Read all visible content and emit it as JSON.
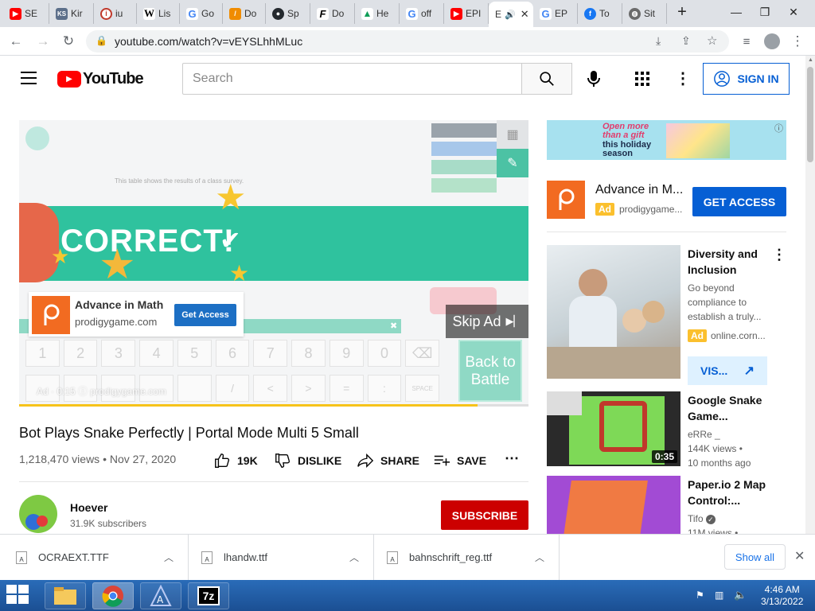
{
  "browser": {
    "tabs": [
      {
        "label": "SE",
        "icon": "youtube-icon",
        "color": "#ff0000",
        "glyph": "▶"
      },
      {
        "label": "Kir",
        "icon": "ks-icon",
        "color": "#5c6f8a",
        "glyph": "KS"
      },
      {
        "label": "iu",
        "icon": "info-icon",
        "color": "#c0392b",
        "glyph": "i"
      },
      {
        "label": "Lis",
        "icon": "wikipedia-icon",
        "color": "#ffffff",
        "glyph": "W"
      },
      {
        "label": "Go",
        "icon": "google-icon",
        "color": "#ffffff",
        "glyph": "G"
      },
      {
        "label": "Do",
        "icon": "doc-icon",
        "color": "#f08c00",
        "glyph": "/"
      },
      {
        "label": "Sp",
        "icon": "github-icon",
        "color": "#24292e",
        "glyph": "●"
      },
      {
        "label": "Do",
        "icon": "font-icon",
        "color": "#ffffff",
        "glyph": "F"
      },
      {
        "label": "He",
        "icon": "drive-icon",
        "color": "#ffffff",
        "glyph": "▲"
      },
      {
        "label": "off",
        "icon": "google-icon",
        "color": "#ffffff",
        "glyph": "G"
      },
      {
        "label": "EPI",
        "icon": "youtube-icon",
        "color": "#ff0000",
        "glyph": "▶"
      },
      {
        "label": "E",
        "icon": "audio-icon",
        "color": "#ffffff",
        "glyph": ""
      },
      {
        "label": "EP",
        "icon": "google-icon",
        "color": "#ffffff",
        "glyph": "G"
      },
      {
        "label": "To",
        "icon": "facebook-icon",
        "color": "#1877f2",
        "glyph": "f"
      },
      {
        "label": "Sit",
        "icon": "globe-icon",
        "color": "#6b6b6b",
        "glyph": "◍"
      }
    ],
    "url": "youtube.com/watch?v=vEYSLhhMLuc"
  },
  "youtube": {
    "logo_text": "YouTube",
    "search_placeholder": "Search",
    "sign_in": "SIGN IN"
  },
  "video": {
    "ad_title": "Advance in Math",
    "ad_domain": "prodigygame.com",
    "ad_button": "Get Access",
    "skip_ad": "Skip Ad",
    "correct_text": "CORRECT!",
    "back_to_battle": "Back to Battle",
    "table_note": "This table shows the results of a class survey.",
    "keypad_keys": [
      "1",
      "2",
      "3",
      "4",
      "5",
      "6",
      "7",
      "8",
      "9",
      "0",
      "⌫"
    ],
    "keypad_keys_2": [
      "",
      "",
      "",
      "",
      "",
      "/",
      "<",
      ">",
      "=",
      ":",
      "SPACE"
    ],
    "ad_footer": "Ad · 0:15 ⓘ prodigygame.com",
    "progress": 0.9
  },
  "watch": {
    "title": "Bot Plays Snake Perfectly | Portal Mode Multi 5 Small",
    "meta": "1,218,470 views • Nov 27, 2020",
    "likes": "19K",
    "dislike": "DISLIKE",
    "share": "SHARE",
    "save": "SAVE",
    "channel": "Hoever",
    "subscribers": "31.9K subscribers",
    "subscribe": "SUBSCRIBE"
  },
  "sidebar": {
    "banner": {
      "line1": "Open more",
      "line2": "than a gift",
      "line3": "this holiday",
      "line4": "season"
    },
    "companion": {
      "title": "Advance in M...",
      "badge": "Ad",
      "domain": "prodigygame...",
      "button": "GET ACCESS"
    },
    "items": [
      {
        "title1": "Diversity and",
        "title2": "Inclusion",
        "desc1": "Go beyond",
        "desc2": "compliance to",
        "desc3": "establish a truly...",
        "badge": "Ad",
        "domain": "online.corn...",
        "button": "VIS..."
      },
      {
        "title1": "Google Snake",
        "title2": "Game...",
        "channel": "eRRe _",
        "views": "144K views •",
        "ago": "10 months ago",
        "duration": "0:35"
      },
      {
        "title1": "Paper.io 2 Map",
        "title2": "Control:...",
        "channel": "Tifo",
        "views": "11M views •"
      }
    ]
  },
  "downloads": {
    "files": [
      "OCRAEXT.TTF",
      "lhandw.ttf",
      "bahnschrift_reg.ttf"
    ],
    "show_all": "Show all"
  },
  "taskbar": {
    "time": "4:46 AM",
    "date": "3/13/2022",
    "apps": [
      "folder-icon",
      "chrome-icon",
      "font-viewer-icon",
      "7zip-icon"
    ],
    "sevenzip_label": "7z"
  }
}
